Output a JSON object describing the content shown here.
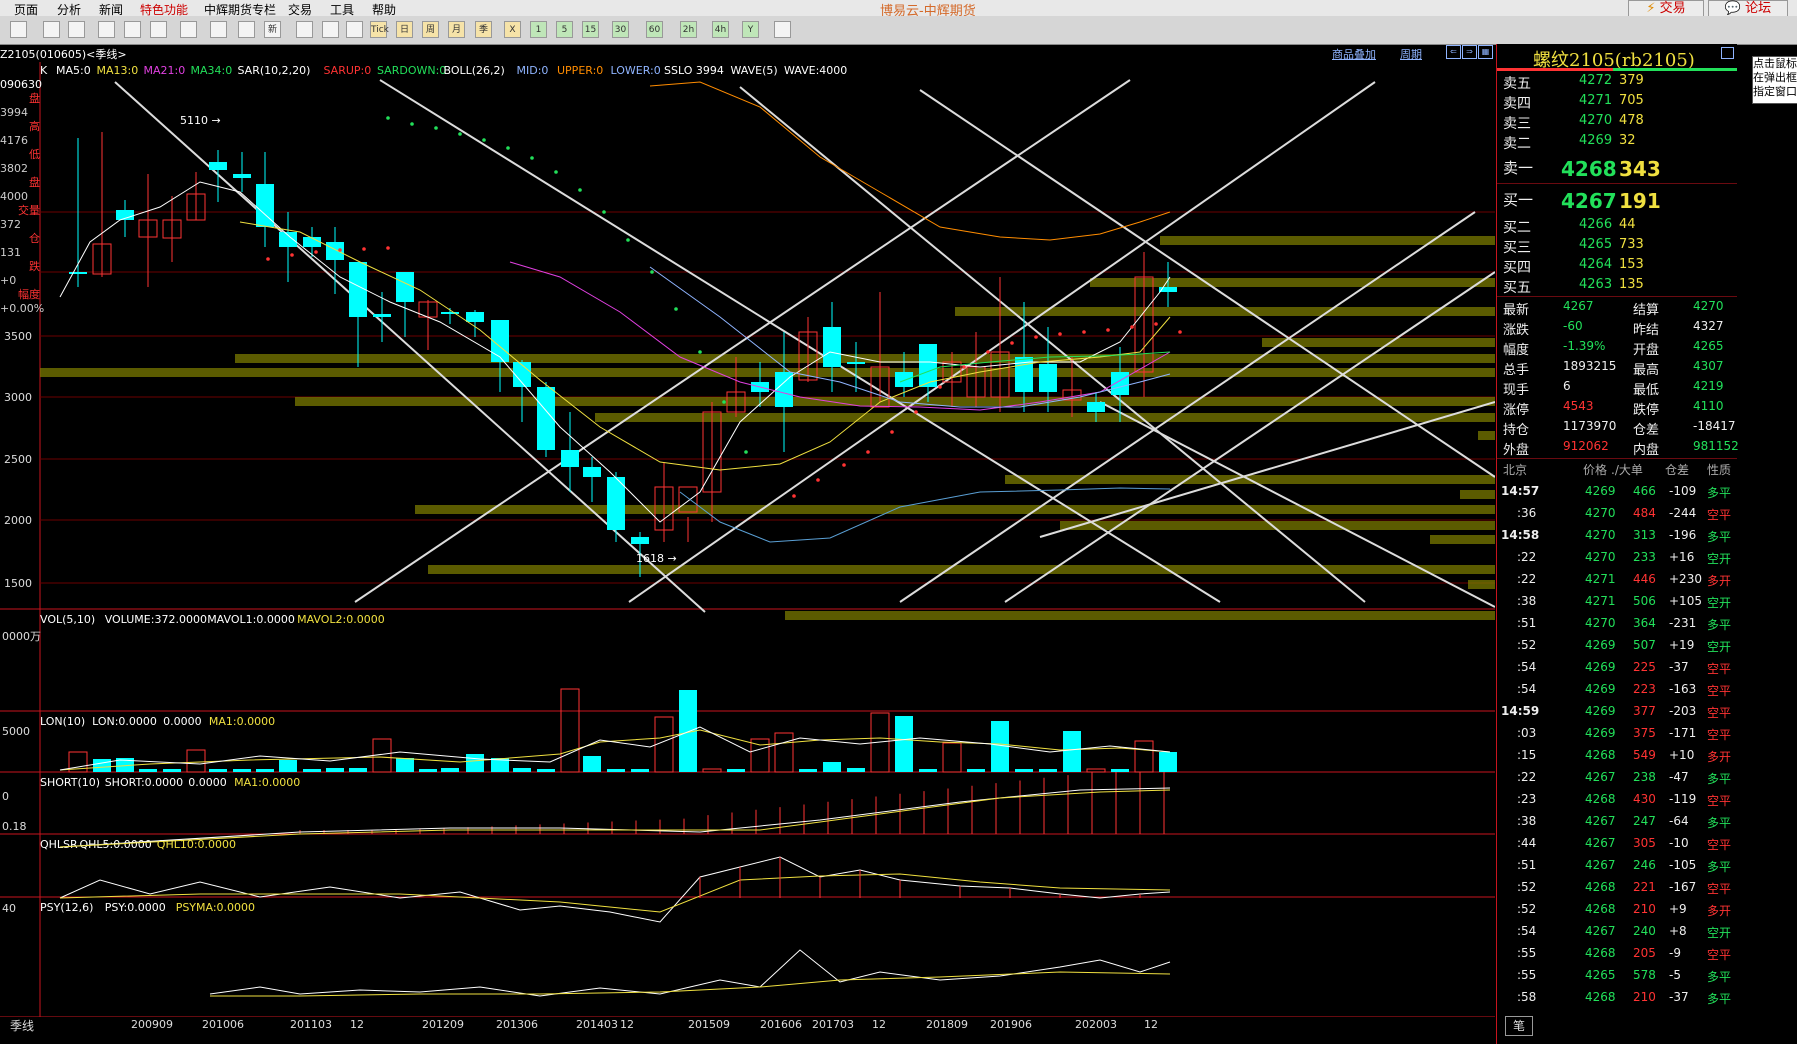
{
  "menu": [
    "页面",
    "分析",
    "新闻",
    "特色功能",
    "中辉期货专栏",
    "交易",
    "工具",
    "帮助"
  ],
  "menu_highlight": "特色功能",
  "app_title": "博易云-中辉期货",
  "trade_button": "交易",
  "forum_button": "论坛",
  "toolbar_icons": [
    "cursor-icon",
    "refresh-icon",
    "refresh-icon",
    "zoom-in-icon",
    "zoom-out-icon",
    "eraser-icon",
    "pen-icon",
    "pen-icon",
    "filter-icon",
    "new-icon",
    "table-icon",
    "keyboard-icon",
    "monitor-icon",
    "tick-icon",
    "day-icon",
    "week-icon",
    "month-icon",
    "season-icon",
    "cross-icon",
    "1min-icon",
    "5min-icon",
    "15min-icon",
    "30min-icon",
    "60min-icon",
    "2h-icon",
    "4h-icon",
    "year-icon",
    "calc-icon"
  ],
  "toolbar_labels": [
    "",
    "",
    "",
    "",
    "",
    "",
    "",
    "",
    "",
    "新",
    "",
    "",
    "",
    "Tick",
    "日",
    "周",
    "月",
    "季",
    "X",
    "1",
    "5",
    "15",
    "30",
    "60",
    "2h",
    "4h",
    "Y",
    ""
  ],
  "chart_head": {
    "symbol": "Z2105(010605)<季线>",
    "overlay_link": "商品叠加",
    "period_link": "周期"
  },
  "main_indicator": {
    "label": "K",
    "items": [
      {
        "t": "MA5:0",
        "c": "#ffffff"
      },
      {
        "t": "MA13:0",
        "c": "#f0e040"
      },
      {
        "t": "MA21:0",
        "c": "#e040e0"
      },
      {
        "t": "MA34:0",
        "c": "#22e05a"
      },
      {
        "t": "SAR(10,2,20)",
        "c": "#ffffff"
      },
      {
        "t": "SARUP:0",
        "c": "#ff3333"
      },
      {
        "t": "SARDOWN:0",
        "c": "#22e05a"
      },
      {
        "t": "BOLL(26,2)",
        "c": "#ffffff"
      },
      {
        "t": "MID:0",
        "c": "#8fb4ff"
      },
      {
        "t": "UPPER:0",
        "c": "#ff8c00"
      },
      {
        "t": "LOWER:0",
        "c": "#8fb4ff"
      },
      {
        "t": "SSLO 3994",
        "c": "#ffffff"
      },
      {
        "t": "WAVE(5)",
        "c": "#ffffff"
      },
      {
        "t": "WAVE:4000",
        "c": "#ffffff"
      }
    ]
  },
  "left_info": [
    "090630",
    "盘",
    "3994",
    "高",
    "4176",
    "低",
    "3802",
    "盘",
    "4000",
    "交量",
    "372",
    "仓",
    "131",
    "跌",
    "+0",
    "幅度",
    "+0.00%"
  ],
  "price_axis": [
    "3500",
    "3000",
    "2500",
    "2000",
    "1500"
  ],
  "annotations": {
    "high": "5110",
    "low": "1618"
  },
  "sub_panels": [
    {
      "name": "vol",
      "title": [
        {
          "t": "VOL(5,10)",
          "c": "#ffffff"
        },
        {
          "t": "VOLUME:372.0000",
          "c": "#ffffff"
        },
        {
          "t": "MAVOL1:0.0000",
          "c": "#ffffff"
        },
        {
          "t": "MAVOL2:0.0000",
          "c": "#f0e040"
        }
      ],
      "axis": "0000万"
    },
    {
      "name": "lon",
      "title": [
        {
          "t": "LON(10)",
          "c": "#ffffff"
        },
        {
          "t": "LON:0.0000",
          "c": "#ffffff"
        },
        {
          "t": "0.0000",
          "c": "#ffffff"
        },
        {
          "t": "MA1:0.0000",
          "c": "#f0e040"
        }
      ],
      "axis": "5000"
    },
    {
      "name": "short",
      "title": [
        {
          "t": "SHORT(10)",
          "c": "#ffffff"
        },
        {
          "t": "SHORT:0.0000",
          "c": "#ffffff"
        },
        {
          "t": "0.0000",
          "c": "#ffffff"
        },
        {
          "t": "MA1:0.0000",
          "c": "#f0e040"
        }
      ],
      "axis": "0"
    },
    {
      "name": "qhlsr",
      "title": [
        {
          "t": "QHLSR",
          "c": "#ffffff"
        },
        {
          "t": "QHL5:0.0000",
          "c": "#ffffff"
        },
        {
          "t": "QHL10:0.0000",
          "c": "#f0e040"
        }
      ],
      "axis": "0.18"
    },
    {
      "name": "psy",
      "title": [
        {
          "t": "PSY(12,6)",
          "c": "#ffffff"
        },
        {
          "t": "PSY:0.0000",
          "c": "#ffffff"
        },
        {
          "t": "PSYMA:0.0000",
          "c": "#f0e040"
        }
      ],
      "axis": "40"
    }
  ],
  "x_axis": {
    "period": "季线",
    "labels": [
      "200909",
      "201006",
      "201103",
      "12",
      "201209",
      "201306",
      "201403",
      "12",
      "201509",
      "201606",
      "201703",
      "12",
      "201809",
      "201906",
      "202003",
      "12"
    ]
  },
  "quote": {
    "title": "螺纹2105(rb2105)",
    "asks": [
      {
        "label": "卖五",
        "price": "4272",
        "vol": "379"
      },
      {
        "label": "卖四",
        "price": "4271",
        "vol": "705"
      },
      {
        "label": "卖三",
        "price": "4270",
        "vol": "478"
      },
      {
        "label": "卖二",
        "price": "4269",
        "vol": "32"
      },
      {
        "label": "卖一",
        "price": "4268",
        "vol": "343"
      }
    ],
    "bids": [
      {
        "label": "买一",
        "price": "4267",
        "vol": "191"
      },
      {
        "label": "买二",
        "price": "4266",
        "vol": "44"
      },
      {
        "label": "买三",
        "price": "4265",
        "vol": "733"
      },
      {
        "label": "买四",
        "price": "4264",
        "vol": "153"
      },
      {
        "label": "买五",
        "price": "4263",
        "vol": "135"
      }
    ],
    "stats": [
      {
        "l1": "最新",
        "v1": "4267",
        "c1": "g",
        "l2": "结算",
        "v2": "4270",
        "c2": "g"
      },
      {
        "l1": "涨跌",
        "v1": "-60",
        "c1": "g",
        "l2": "昨结",
        "v2": "4327",
        "c2": "w"
      },
      {
        "l1": "幅度",
        "v1": "-1.39%",
        "c1": "g",
        "l2": "开盘",
        "v2": "4265",
        "c2": "g"
      },
      {
        "l1": "总手",
        "v1": "1893215",
        "c1": "w",
        "l2": "最高",
        "v2": "4307",
        "c2": "g"
      },
      {
        "l1": "现手",
        "v1": "6",
        "c1": "w",
        "l2": "最低",
        "v2": "4219",
        "c2": "g"
      },
      {
        "l1": "涨停",
        "v1": "4543",
        "c1": "r",
        "l2": "跌停",
        "v2": "4110",
        "c2": "g"
      },
      {
        "l1": "持仓",
        "v1": "1173970",
        "c1": "w",
        "l2": "仓差",
        "v2": "-18417",
        "c2": "w"
      },
      {
        "l1": "外盘",
        "v1": "912062",
        "c1": "r",
        "l2": "内盘",
        "v2": "981152",
        "c2": "g"
      }
    ],
    "tick_header": [
      "北京",
      "价格",
      "./大单",
      "仓差",
      "性质"
    ],
    "ticks": [
      {
        "t": "14:57",
        "p": "4269",
        "v": "466",
        "vc": "g",
        "d": "-109",
        "n": "多平",
        "nc": "g"
      },
      {
        "t": ":36",
        "p": "4270",
        "v": "484",
        "vc": "r",
        "d": "-244",
        "n": "空平",
        "nc": "r"
      },
      {
        "t": "14:58",
        "p": "4270",
        "v": "313",
        "vc": "g",
        "d": "-196",
        "n": "多平",
        "nc": "g"
      },
      {
        "t": ":22",
        "p": "4270",
        "v": "233",
        "vc": "g",
        "d": "+16",
        "n": "空开",
        "nc": "g"
      },
      {
        "t": ":22",
        "p": "4271",
        "v": "446",
        "vc": "r",
        "d": "+230",
        "n": "多开",
        "nc": "r"
      },
      {
        "t": ":38",
        "p": "4271",
        "v": "506",
        "vc": "g",
        "d": "+105",
        "n": "空开",
        "nc": "g"
      },
      {
        "t": ":51",
        "p": "4270",
        "v": "364",
        "vc": "g",
        "d": "-231",
        "n": "多平",
        "nc": "g"
      },
      {
        "t": ":52",
        "p": "4269",
        "v": "507",
        "vc": "g",
        "d": "+19",
        "n": "空开",
        "nc": "g"
      },
      {
        "t": ":54",
        "p": "4269",
        "v": "225",
        "vc": "r",
        "d": "-37",
        "n": "空平",
        "nc": "r"
      },
      {
        "t": ":54",
        "p": "4269",
        "v": "223",
        "vc": "r",
        "d": "-163",
        "n": "空平",
        "nc": "r"
      },
      {
        "t": "14:59",
        "p": "4269",
        "v": "377",
        "vc": "r",
        "d": "-203",
        "n": "空平",
        "nc": "r"
      },
      {
        "t": ":03",
        "p": "4269",
        "v": "375",
        "vc": "r",
        "d": "-171",
        "n": "空平",
        "nc": "r"
      },
      {
        "t": ":15",
        "p": "4268",
        "v": "549",
        "vc": "r",
        "d": "+10",
        "n": "多开",
        "nc": "r"
      },
      {
        "t": ":22",
        "p": "4267",
        "v": "238",
        "vc": "g",
        "d": "-47",
        "n": "多平",
        "nc": "g"
      },
      {
        "t": ":23",
        "p": "4268",
        "v": "430",
        "vc": "r",
        "d": "-119",
        "n": "空平",
        "nc": "r"
      },
      {
        "t": ":38",
        "p": "4267",
        "v": "247",
        "vc": "g",
        "d": "-64",
        "n": "多平",
        "nc": "g"
      },
      {
        "t": ":44",
        "p": "4267",
        "v": "305",
        "vc": "r",
        "d": "-10",
        "n": "空平",
        "nc": "r"
      },
      {
        "t": ":51",
        "p": "4267",
        "v": "246",
        "vc": "g",
        "d": "-105",
        "n": "多平",
        "nc": "g"
      },
      {
        "t": ":52",
        "p": "4268",
        "v": "221",
        "vc": "r",
        "d": "-167",
        "n": "空平",
        "nc": "r"
      },
      {
        "t": ":52",
        "p": "4268",
        "v": "210",
        "vc": "r",
        "d": "+9",
        "n": "多开",
        "nc": "r"
      },
      {
        "t": ":54",
        "p": "4267",
        "v": "240",
        "vc": "g",
        "d": "+8",
        "n": "空开",
        "nc": "g"
      },
      {
        "t": ":55",
        "p": "4268",
        "v": "205",
        "vc": "r",
        "d": "-9",
        "n": "空平",
        "nc": "r"
      },
      {
        "t": ":55",
        "p": "4265",
        "v": "578",
        "vc": "g",
        "d": "-5",
        "n": "多平",
        "nc": "g"
      },
      {
        "t": ":58",
        "p": "4268",
        "v": "210",
        "vc": "r",
        "d": "-37",
        "n": "多平",
        "nc": "g"
      }
    ],
    "footer_tab": "笔"
  },
  "popup_text": "点击鼠标在弹出框指定窗口",
  "colors": {
    "up": "#ff3333",
    "down": "#00ffff",
    "bg": "#000000",
    "grid": "#8b0000",
    "ask_price": "#22e05a",
    "bid_price": "#22e05a",
    "volume_yellow": "#f0e040"
  },
  "chart_data": {
    "type": "candlestick",
    "candles": [
      [
        1,
        0,
        0,
        0,
        0
      ]
    ]
  }
}
